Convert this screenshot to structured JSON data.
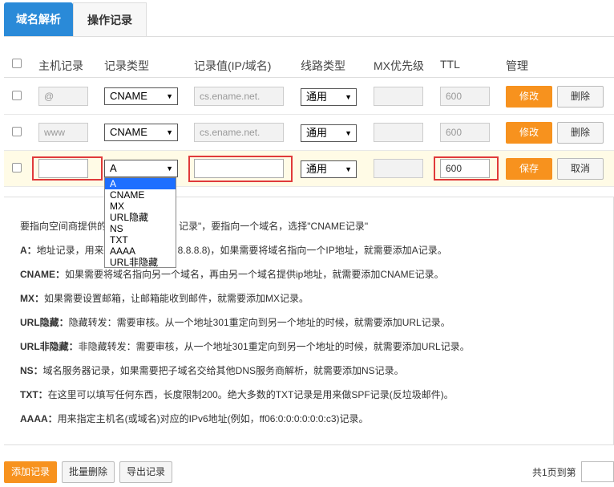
{
  "tabs": {
    "active": "域名解析",
    "inactive": "操作记录"
  },
  "headers": {
    "host": "主机记录",
    "type": "记录类型",
    "value": "记录值(IP/域名)",
    "line": "线路类型",
    "mx": "MX优先级",
    "ttl": "TTL",
    "manage": "管理"
  },
  "rows": [
    {
      "host": "@",
      "type": "CNAME",
      "value": "cs.ename.net.",
      "line": "通用",
      "mx": "",
      "ttl": "600",
      "btn1": "修改",
      "btn2": "删除"
    },
    {
      "host": "www",
      "type": "CNAME",
      "value": "cs.ename.net.",
      "line": "通用",
      "mx": "",
      "ttl": "600",
      "btn1": "修改",
      "btn2": "删除"
    }
  ],
  "edit_row": {
    "host": "",
    "type": "A",
    "value": "",
    "line": "通用",
    "mx": "",
    "ttl": "600",
    "save": "保存",
    "cancel": "取消"
  },
  "dropdown_options": [
    "A",
    "CNAME",
    "MX",
    "URL隐藏",
    "NS",
    "TXT",
    "AAAA",
    "URL非隐藏"
  ],
  "help": {
    "intro": "要指向空间商提供的",
    "intro2": "记录\"，要指向一个域名，选择\"CNAME记录\"",
    "a_label": "A：",
    "a_pre": "地址记录，用来",
    "a_text": "地址(如，8.8.8.8)，如果需要将域名指向一个IP地址，就需要添加A记录。",
    "cname_label": "CNAME：",
    "cname_text": "如果需要将域名指向另一个域名，再由另一个域名提供ip地址，就需要添加CNAME记录。",
    "mx_label": "MX：",
    "mx_text": "如果需要设置邮箱，让邮箱能收到邮件，就需要添加MX记录。",
    "urlh_label": "URL隐藏：",
    "urlh_text": "隐藏转发：需要审核。从一个地址301重定向到另一个地址的时候，就需要添加URL记录。",
    "urlnh_label": "URL非隐藏：",
    "urlnh_text": "非隐藏转发：需要审核，从一个地址301重定向到另一个地址的时候，就需要添加URL记录。",
    "ns_label": "NS：",
    "ns_text": "域名服务器记录，如果需要把子域名交给其他DNS服务商解析，就需要添加NS记录。",
    "txt_label": "TXT：",
    "txt_text": "在这里可以填写任何东西，长度限制200。绝大多数的TXT记录是用来做SPF记录(反垃圾邮件)。",
    "aaaa_label": "AAAA：",
    "aaaa_text": "用来指定主机名(或域名)对应的IPv6地址(例如，ff06:0:0:0:0:0:0:c3)记录。"
  },
  "footer": {
    "add": "添加记录",
    "batch_delete": "批量删除",
    "export": "导出记录",
    "pages": "共1页到第"
  }
}
